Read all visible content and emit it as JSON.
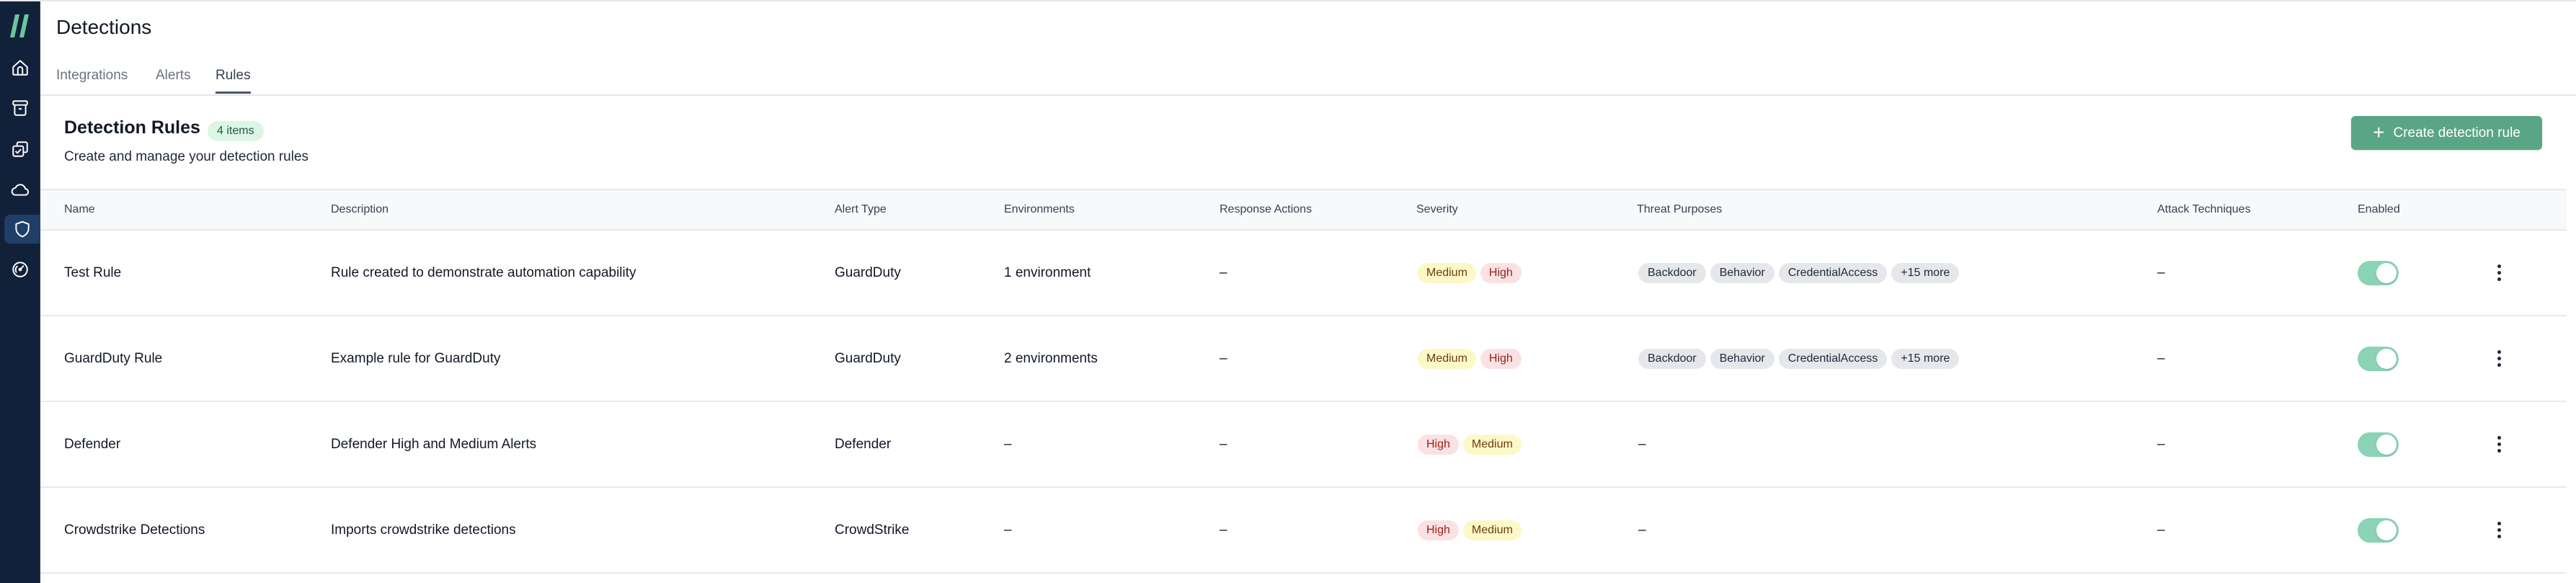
{
  "app": {
    "logo": "slash-logo",
    "sidebar": [
      {
        "name": "home",
        "icon": "home-icon",
        "active": false
      },
      {
        "name": "archive",
        "icon": "archive-icon",
        "active": false
      },
      {
        "name": "tasks",
        "icon": "stacked-checkbox-icon",
        "active": false
      },
      {
        "name": "cloud",
        "icon": "cloud-icon",
        "active": false
      },
      {
        "name": "detections",
        "icon": "shield-icon",
        "active": true
      },
      {
        "name": "dashboard",
        "icon": "gauge-icon",
        "active": false
      }
    ]
  },
  "page": {
    "title": "Detections",
    "tabs": [
      {
        "label": "Integrations",
        "active": false
      },
      {
        "label": "Alerts",
        "active": false
      },
      {
        "label": "Rules",
        "active": true
      }
    ]
  },
  "section": {
    "title": "Detection Rules",
    "count_badge": "4 items",
    "subtitle": "Create and manage your detection rules",
    "create_button": "Create detection rule"
  },
  "table": {
    "columns": [
      "Name",
      "Description",
      "Alert Type",
      "Environments",
      "Response Actions",
      "Severity",
      "Threat Purposes",
      "Attack Techniques",
      "Enabled",
      ""
    ],
    "rows": [
      {
        "name": "Test Rule",
        "description": "Rule created to demonstrate automation capability",
        "alert_type": "GuardDuty",
        "environments": "1 environment",
        "response_actions": "–",
        "severity": [
          {
            "label": "Medium",
            "level": "medium"
          },
          {
            "label": "High",
            "level": "high"
          }
        ],
        "threat_purposes": [
          "Backdoor",
          "Behavior",
          "CredentialAccess",
          "+15 more"
        ],
        "attack_techniques": "–",
        "enabled": true
      },
      {
        "name": "GuardDuty Rule",
        "description": "Example rule for GuardDuty",
        "alert_type": "GuardDuty",
        "environments": "2 environments",
        "response_actions": "–",
        "severity": [
          {
            "label": "Medium",
            "level": "medium"
          },
          {
            "label": "High",
            "level": "high"
          }
        ],
        "threat_purposes": [
          "Backdoor",
          "Behavior",
          "CredentialAccess",
          "+15 more"
        ],
        "attack_techniques": "–",
        "enabled": true
      },
      {
        "name": "Defender",
        "description": "Defender High and Medium Alerts",
        "alert_type": "Defender",
        "environments": "–",
        "response_actions": "–",
        "severity": [
          {
            "label": "High",
            "level": "high"
          },
          {
            "label": "Medium",
            "level": "medium"
          }
        ],
        "threat_purposes": [],
        "threat_purposes_empty": "–",
        "attack_techniques": "–",
        "enabled": true
      },
      {
        "name": "Crowdstrike Detections",
        "description": "Imports crowdstrike detections",
        "alert_type": "CrowdStrike",
        "environments": "–",
        "response_actions": "–",
        "severity": [
          {
            "label": "High",
            "level": "high"
          },
          {
            "label": "Medium",
            "level": "medium"
          }
        ],
        "threat_purposes": [],
        "threat_purposes_empty": "–",
        "attack_techniques": "–",
        "enabled": true
      }
    ]
  },
  "colors": {
    "sidebar_bg": "#12213a",
    "accent": "#5aa585",
    "toggle_on": "#8ad3b4",
    "badge_bg": "#dcf6e6",
    "severity_medium_bg": "#fdf8c8",
    "severity_high_bg": "#fbe2e2"
  }
}
